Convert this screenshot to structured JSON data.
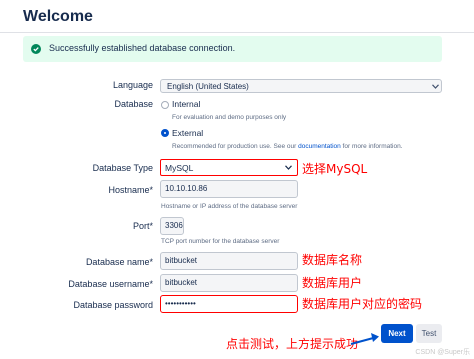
{
  "header": {
    "title": "Welcome"
  },
  "banner": {
    "message": "Successfully established database connection."
  },
  "form": {
    "language": {
      "label": "Language",
      "value": "English (United States)"
    },
    "database": {
      "label": "Database",
      "internal": {
        "label": "Internal",
        "hint": "For evaluation and demo purposes only",
        "checked": false
      },
      "external": {
        "label": "External",
        "hint_before": "Recommended for production use. See our ",
        "hint_link": "documentation",
        "hint_after": " for more information.",
        "checked": true
      }
    },
    "database_type": {
      "label": "Database Type",
      "value": "MySQL"
    },
    "hostname": {
      "label": "Hostname",
      "required_mark": "*",
      "value": "10.10.10.86",
      "hint": "Hostname or IP address of the database server"
    },
    "port": {
      "label": "Port",
      "required_mark": "*",
      "value": "3306",
      "hint": "TCP port number for the database server"
    },
    "db_name": {
      "label": "Database name",
      "required_mark": "*",
      "value": "bitbucket"
    },
    "db_username": {
      "label": "Database username",
      "required_mark": "*",
      "value": "bitbucket"
    },
    "db_password": {
      "label": "Database password",
      "value": "•••••••••••"
    }
  },
  "buttons": {
    "next": "Next",
    "test": "Test"
  },
  "annotations": {
    "select_mysql": "选择MySQL",
    "db_name": "数据库名称",
    "db_user": "数据库用户",
    "db_password": "数据库用户对应的密码",
    "test_hint": "点击测试，上方提示成功"
  },
  "watermark": "CSDN @Super乐",
  "colors": {
    "accent": "#0052cc",
    "annotation": "#ff0000",
    "success_bg": "#e3fcef",
    "success_icon": "#00875a"
  }
}
